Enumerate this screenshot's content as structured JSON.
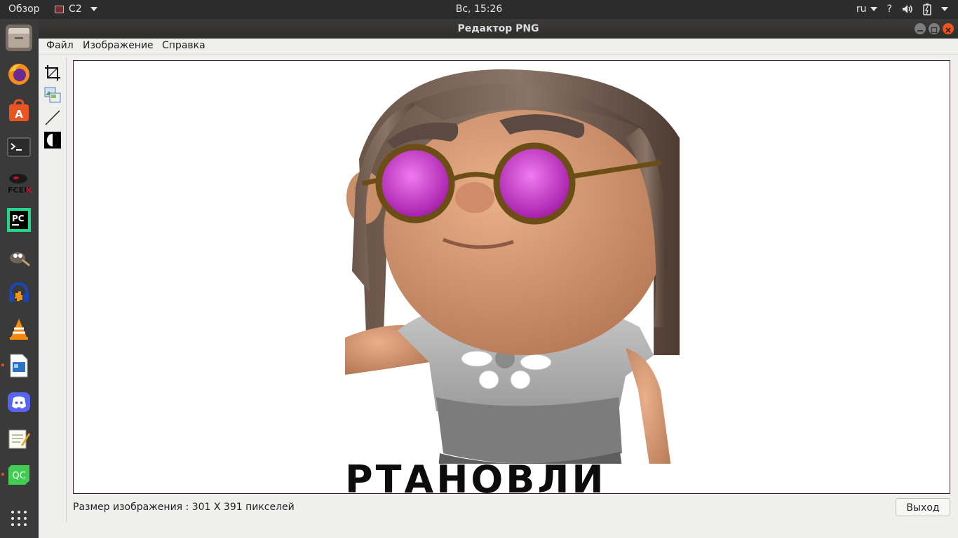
{
  "topbar": {
    "overview": "Обзор",
    "app_name": "C2",
    "clock": "Вс, 15:26",
    "lang": "ru",
    "help": "?"
  },
  "dock": {
    "items": [
      {
        "name": "files-icon"
      },
      {
        "name": "firefox-icon"
      },
      {
        "name": "software-center-icon"
      },
      {
        "name": "terminal-icon"
      },
      {
        "name": "fceux-icon",
        "label": "FCEUX"
      },
      {
        "name": "pycharm-icon",
        "label": "PC"
      },
      {
        "name": "gimp-icon"
      },
      {
        "name": "audacity-icon"
      },
      {
        "name": "vlc-icon"
      },
      {
        "name": "writer-icon"
      },
      {
        "name": "discord-icon"
      },
      {
        "name": "text-editor-icon"
      },
      {
        "name": "qtcreator-icon",
        "label": "QC"
      },
      {
        "name": "show-apps-icon"
      }
    ]
  },
  "window": {
    "title": "Редактор PNG"
  },
  "menu": {
    "file": "Файл",
    "image": "Изображение",
    "help": "Справка"
  },
  "tools": [
    {
      "name": "crop-tool-icon"
    },
    {
      "name": "insert-image-tool-icon"
    },
    {
      "name": "line-tool-icon"
    },
    {
      "name": "invert-tool-icon"
    }
  ],
  "canvas": {
    "image_caption_fragment": "РТАНОВЛИ"
  },
  "status": {
    "size_text": "Размер изображения : 301 X 391 пикселей",
    "exit_label": "Выход"
  },
  "colors": {
    "topbar_bg": "#2c2c2c",
    "dock_bg": "#3a3a3a",
    "close_button": "#e9541f",
    "window_bg": "#efefed"
  }
}
